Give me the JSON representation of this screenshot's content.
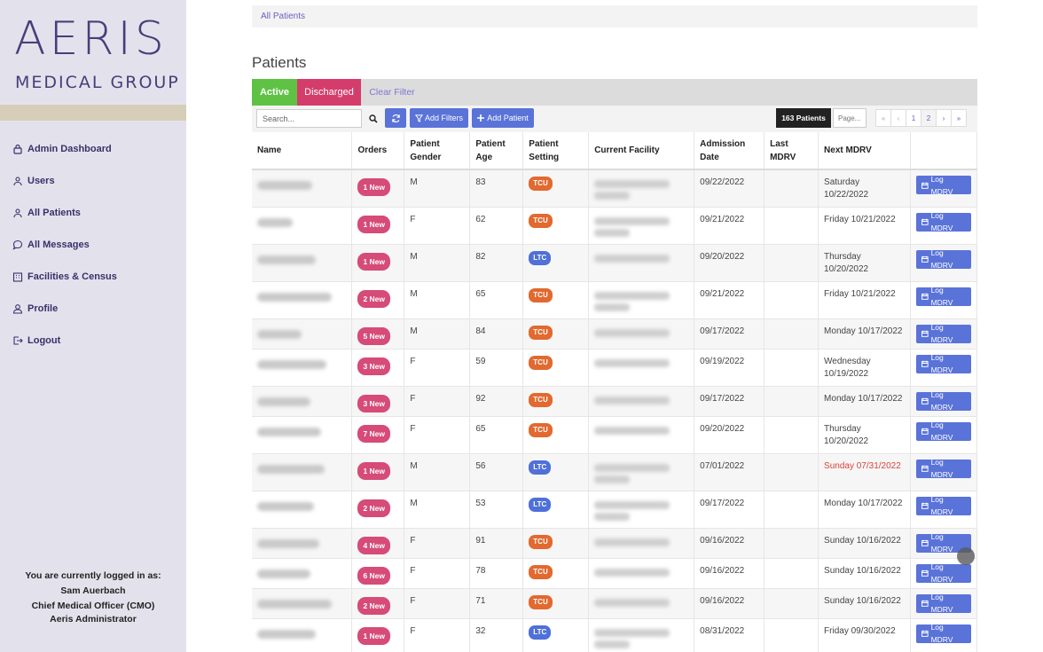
{
  "brand": {
    "top": "AERIS",
    "sub": "MEDICAL GROUP"
  },
  "nav": [
    {
      "label": "Admin Dashboard",
      "icon": "lock-icon"
    },
    {
      "label": "Users",
      "icon": "users-icon"
    },
    {
      "label": "All Patients",
      "icon": "users-icon"
    },
    {
      "label": "All Messages",
      "icon": "message-icon"
    },
    {
      "label": "Facilities & Census",
      "icon": "building-icon"
    },
    {
      "label": "Profile",
      "icon": "user-icon"
    },
    {
      "label": "Logout",
      "icon": "logout-icon"
    }
  ],
  "user": {
    "heading": "You are currently logged in as:",
    "name": "Sam Auerbach",
    "role1": "Chief Medical Officer (CMO)",
    "role2": "Aeris Administrator"
  },
  "breadcrumb": "All Patients",
  "page_title": "Patients",
  "tabs": {
    "active": "Active",
    "discharged": "Discharged",
    "clear": "Clear Filter"
  },
  "toolbar": {
    "search_placeholder": "Search...",
    "add_filters": "Add Filters",
    "add_patient": "Add Patient",
    "count": "163 Patients",
    "page_placeholder": "Page...",
    "pager": [
      "«",
      "‹",
      "1",
      "2",
      "›",
      "»"
    ]
  },
  "columns": [
    "Name",
    "Orders",
    "Patient Gender",
    "Patient Age",
    "Patient Setting",
    "Current Facility",
    "Admission Date",
    "Last MDRV",
    "Next MDRV",
    ""
  ],
  "log_label": "Log MDRV",
  "rows": [
    {
      "orders": "1 New",
      "gender": "M",
      "age": "83",
      "setting": "TCU",
      "admission": "09/22/2022",
      "last": "",
      "next": "Saturday 10/22/2022",
      "overdue": false
    },
    {
      "orders": "1 New",
      "gender": "F",
      "age": "62",
      "setting": "TCU",
      "admission": "09/21/2022",
      "last": "",
      "next": "Friday 10/21/2022",
      "overdue": false
    },
    {
      "orders": "1 New",
      "gender": "M",
      "age": "82",
      "setting": "LTC",
      "admission": "09/20/2022",
      "last": "",
      "next": "Thursday 10/20/2022",
      "overdue": false
    },
    {
      "orders": "2 New",
      "gender": "M",
      "age": "65",
      "setting": "TCU",
      "admission": "09/21/2022",
      "last": "",
      "next": "Friday 10/21/2022",
      "overdue": false
    },
    {
      "orders": "5 New",
      "gender": "M",
      "age": "84",
      "setting": "TCU",
      "admission": "09/17/2022",
      "last": "",
      "next": "Monday 10/17/2022",
      "overdue": false
    },
    {
      "orders": "3 New",
      "gender": "F",
      "age": "59",
      "setting": "TCU",
      "admission": "09/19/2022",
      "last": "",
      "next": "Wednesday 10/19/2022",
      "overdue": false
    },
    {
      "orders": "3 New",
      "gender": "F",
      "age": "92",
      "setting": "TCU",
      "admission": "09/17/2022",
      "last": "",
      "next": "Monday 10/17/2022",
      "overdue": false
    },
    {
      "orders": "7 New",
      "gender": "F",
      "age": "65",
      "setting": "TCU",
      "admission": "09/20/2022",
      "last": "",
      "next": "Thursday 10/20/2022",
      "overdue": false
    },
    {
      "orders": "1 New",
      "gender": "M",
      "age": "56",
      "setting": "LTC",
      "admission": "07/01/2022",
      "last": "",
      "next": "Sunday 07/31/2022",
      "overdue": true
    },
    {
      "orders": "2 New",
      "gender": "M",
      "age": "53",
      "setting": "LTC",
      "admission": "09/17/2022",
      "last": "",
      "next": "Monday 10/17/2022",
      "overdue": false
    },
    {
      "orders": "4 New",
      "gender": "F",
      "age": "91",
      "setting": "TCU",
      "admission": "09/16/2022",
      "last": "",
      "next": "Sunday 10/16/2022",
      "overdue": false
    },
    {
      "orders": "6 New",
      "gender": "F",
      "age": "78",
      "setting": "TCU",
      "admission": "09/16/2022",
      "last": "",
      "next": "Sunday 10/16/2022",
      "overdue": false
    },
    {
      "orders": "2 New",
      "gender": "F",
      "age": "71",
      "setting": "TCU",
      "admission": "09/16/2022",
      "last": "",
      "next": "Sunday 10/16/2022",
      "overdue": false
    },
    {
      "orders": "1 New",
      "gender": "F",
      "age": "32",
      "setting": "LTC",
      "admission": "08/31/2022",
      "last": "",
      "next": "Friday 09/30/2022",
      "overdue": false
    }
  ]
}
